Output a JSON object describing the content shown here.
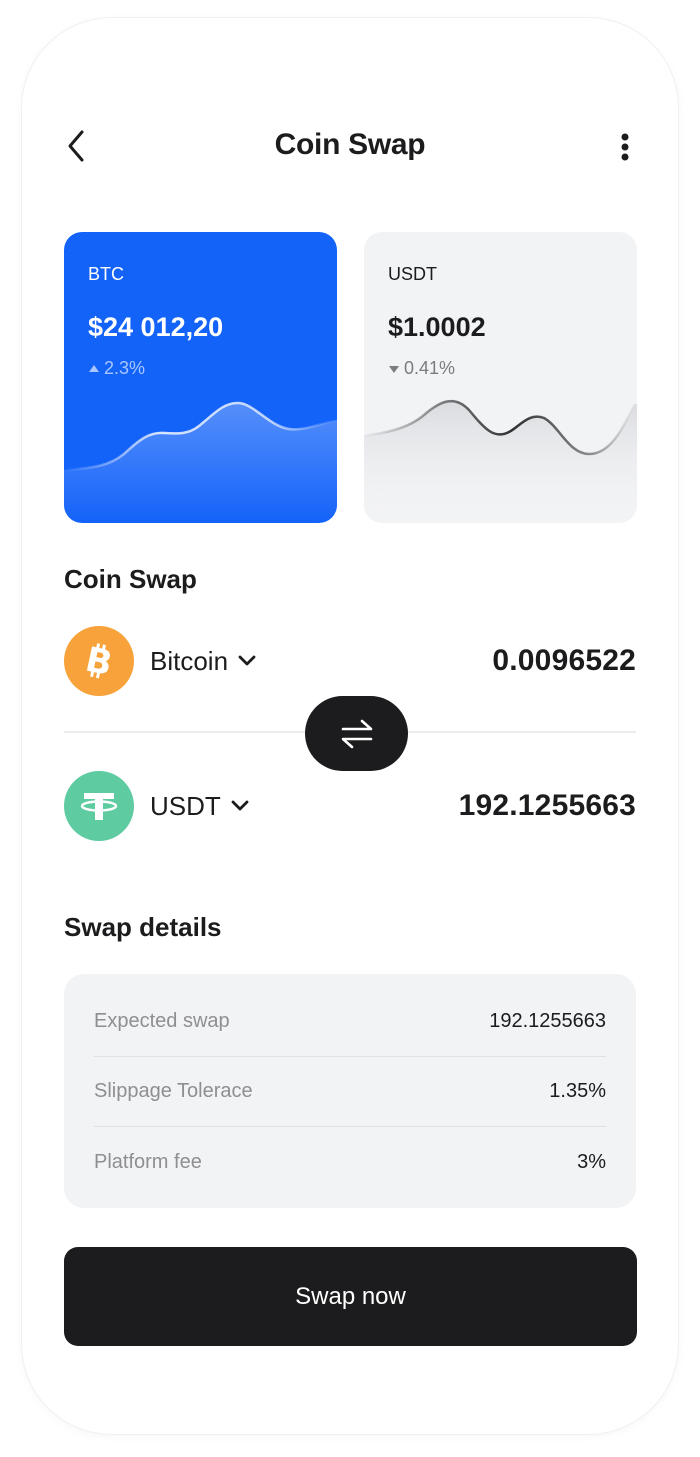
{
  "header": {
    "title": "Coin Swap",
    "back_icon": "chevron-left-icon",
    "more_icon": "more-vertical-icon"
  },
  "cards": [
    {
      "symbol": "BTC",
      "price": "$24 012,20",
      "change": "2.3%",
      "direction": "up",
      "color": "#1463f9"
    },
    {
      "symbol": "USDT",
      "price": "$1.0002",
      "change": "0.41%",
      "direction": "down",
      "color": "#f2f3f5"
    }
  ],
  "swap": {
    "section_title": "Coin Swap",
    "from": {
      "name": "Bitcoin",
      "amount": "0.0096522",
      "icon": "bitcoin-icon",
      "color": "#f7a23b"
    },
    "to": {
      "name": "USDT",
      "amount": "192.1255663",
      "icon": "tether-icon",
      "color": "#5ecba1"
    },
    "swap_icon": "swap-arrows-icon"
  },
  "details": {
    "section_title": "Swap details",
    "rows": [
      {
        "label": "Expected swap",
        "value": "192.1255663"
      },
      {
        "label": "Slippage Tolerace",
        "value": "1.35%"
      },
      {
        "label": "Platform fee",
        "value": "3%"
      }
    ]
  },
  "cta": {
    "label": "Swap now"
  }
}
